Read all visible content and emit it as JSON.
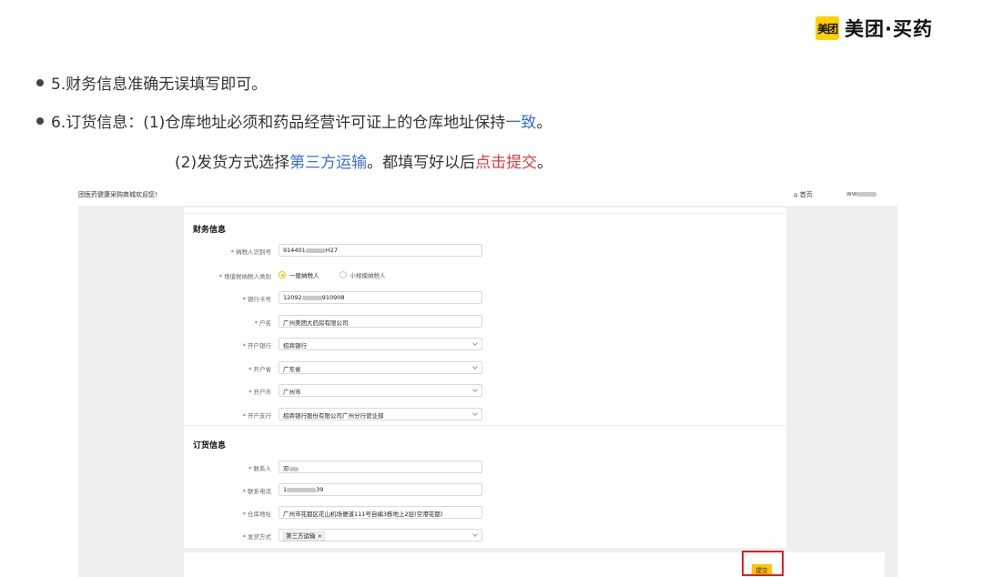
{
  "logo": {
    "badge": "美团",
    "text": "美团·买药"
  },
  "bullets": {
    "b1": "5.财务信息准确无误填写即可。",
    "b2_pre": "6.订货信息：(1)仓库地址必须和药品经营许可证上的仓库地址保持",
    "b2_hl": "一致",
    "b2_post": "。",
    "b3_pre": "(2)发货方式选择",
    "b3_hl1": "第三方运输",
    "b3_mid": "。都填写好以后",
    "b3_hl2": "点击提交",
    "b3_post": "。"
  },
  "shot": {
    "welcome": "团医药健康采购商城欢迎您!",
    "home": "⌂ 首页",
    "user": "ww",
    "finance": {
      "title": "财务信息",
      "tax_id_label": "纳税人识别号",
      "tax_id_a": "914401",
      "tax_id_b": "H27",
      "taxpayer_type_label": "增值税纳税人类别",
      "taxpayer_general": "一般纳税人",
      "taxpayer_small": "小规模纳税人",
      "bank_card_label": "银行卡号",
      "bank_card_a": "12092",
      "bank_card_b": "910908",
      "account_name_label": "户名",
      "account_name": "广州美团大药房有限公司",
      "bank_label": "开户银行",
      "bank": "招商银行",
      "province_label": "开户省",
      "province": "广东省",
      "city_label": "开户市",
      "city": "广州市",
      "branch_label": "开户支行",
      "branch": "招商银行股份有限公司广州分行营业部"
    },
    "order": {
      "title": "订货信息",
      "contact_label": "联系人",
      "contact": "邓",
      "phone_label": "联系电话",
      "phone_a": "1",
      "phone_b": "39",
      "warehouse_label": "仓库地址",
      "warehouse": "广州市花都区花山机场便道111号自编3栋地上2层(空港花都)",
      "shipping_label": "发货方式",
      "shipping": "第三方运输",
      "tag_close": "×"
    },
    "submit": "提交"
  },
  "colors": {
    "brand_yellow": "#ffd100",
    "required_red": "#e02020",
    "highlight_blue": "#3a6fd8",
    "highlight_red": "#e23a3a"
  }
}
